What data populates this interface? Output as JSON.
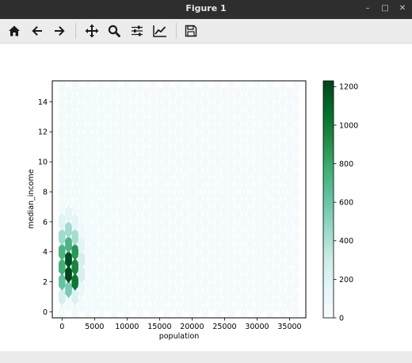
{
  "window": {
    "title": "Figure 1",
    "minimize_glyph": "–",
    "maximize_glyph": "□",
    "close_glyph": "✕"
  },
  "toolbar": {
    "tools": [
      {
        "icon": "home-icon",
        "label": "Home"
      },
      {
        "icon": "back-arrow-icon",
        "label": "Back"
      },
      {
        "icon": "forward-arrow-icon",
        "label": "Forward"
      },
      {
        "icon": "pan-move-icon",
        "label": "Pan"
      },
      {
        "icon": "zoom-magnifier-icon",
        "label": "Zoom"
      },
      {
        "icon": "configure-subplots-icon",
        "label": "Subplots"
      },
      {
        "icon": "edit-axis-icon",
        "label": "Customize"
      },
      {
        "icon": "save-floppy-icon",
        "label": "Save"
      }
    ]
  },
  "chart_data": {
    "type": "heatmap",
    "subtype": "hexbin",
    "xlabel": "population",
    "ylabel": "median_income",
    "xlim": [
      -1500,
      37500
    ],
    "ylim": [
      -0.4,
      15.4
    ],
    "xticks": [
      "0",
      "5000",
      "10000",
      "15000",
      "20000",
      "25000",
      "30000",
      "35000"
    ],
    "xtick_values": [
      0,
      5000,
      10000,
      15000,
      20000,
      25000,
      30000,
      35000
    ],
    "yticks": [
      "0",
      "2",
      "4",
      "6",
      "8",
      "10",
      "12",
      "14"
    ],
    "ytick_values": [
      0,
      2,
      4,
      6,
      8,
      10,
      12,
      14
    ],
    "colorbar": {
      "ticks": [
        "0",
        "200",
        "400",
        "600",
        "800",
        "1000",
        "1200"
      ],
      "tick_values": [
        0,
        200,
        400,
        600,
        800,
        1000,
        1200
      ],
      "range": [
        0,
        1230
      ],
      "colormap": "BuGn",
      "colors": [
        "#f7fcfd",
        "#e5f5f9",
        "#ccece6",
        "#99d8c9",
        "#66c2a4",
        "#41ae76",
        "#238b45",
        "#006d2c",
        "#00441b"
      ]
    },
    "grid": false,
    "hex_bins": [
      {
        "x": 0,
        "y": 1.0,
        "count": 250
      },
      {
        "x": 0,
        "y": 2.0,
        "count": 620
      },
      {
        "x": 0,
        "y": 3.0,
        "count": 760
      },
      {
        "x": 0,
        "y": 4.0,
        "count": 720
      },
      {
        "x": 0,
        "y": 5.0,
        "count": 440
      },
      {
        "x": 0,
        "y": 6.0,
        "count": 180
      },
      {
        "x": 1000,
        "y": 1.5,
        "count": 560
      },
      {
        "x": 1000,
        "y": 2.5,
        "count": 1220
      },
      {
        "x": 1000,
        "y": 3.5,
        "count": 1180
      },
      {
        "x": 1000,
        "y": 4.5,
        "count": 720
      },
      {
        "x": 1000,
        "y": 5.5,
        "count": 430
      },
      {
        "x": 1000,
        "y": 6.5,
        "count": 150
      },
      {
        "x": 2000,
        "y": 1.0,
        "count": 200
      },
      {
        "x": 2000,
        "y": 2.0,
        "count": 1020
      },
      {
        "x": 2000,
        "y": 3.0,
        "count": 960
      },
      {
        "x": 2000,
        "y": 4.0,
        "count": 880
      },
      {
        "x": 2000,
        "y": 5.0,
        "count": 420
      },
      {
        "x": 2000,
        "y": 6.0,
        "count": 160
      },
      {
        "x": 3000,
        "y": 1.5,
        "count": 120
      },
      {
        "x": 3000,
        "y": 2.5,
        "count": 240
      },
      {
        "x": 3000,
        "y": 3.5,
        "count": 260
      },
      {
        "x": 3000,
        "y": 4.5,
        "count": 160
      },
      {
        "x": 3000,
        "y": 5.5,
        "count": 70
      }
    ]
  }
}
